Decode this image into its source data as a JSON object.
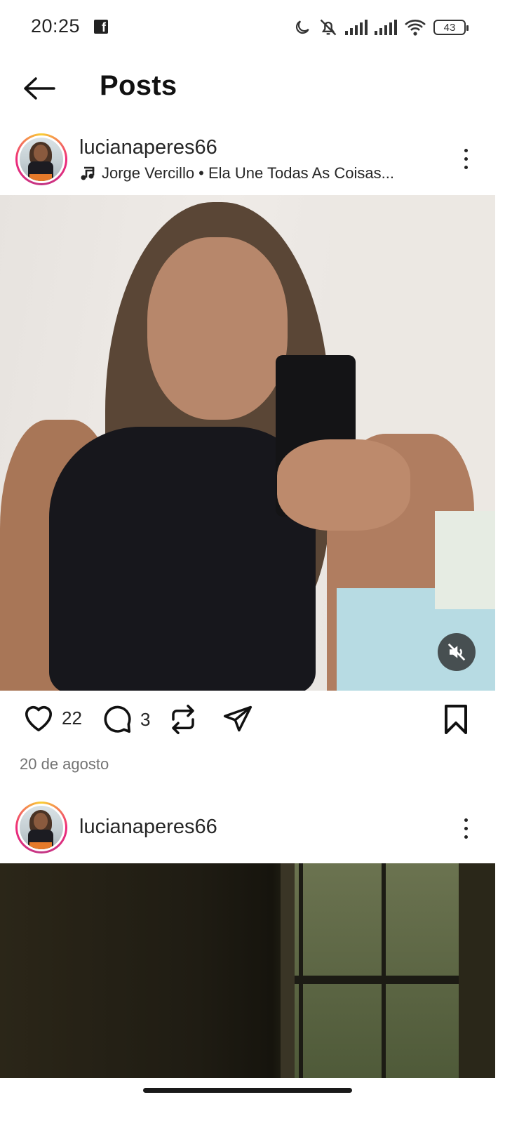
{
  "status_bar": {
    "time": "20:25",
    "battery": "43",
    "icons": [
      "facebook-icon",
      "moon-icon",
      "bell-off-icon",
      "signal-icon",
      "signal-icon",
      "wifi-icon",
      "battery-icon"
    ]
  },
  "header": {
    "title": "Posts",
    "back_icon": "arrow-left-icon"
  },
  "posts": [
    {
      "username": "lucianaperes66",
      "music": "Jorge Vercillo • Ela Une Todas As Coisas...",
      "likes": "22",
      "comments": "3",
      "date": "20 de agosto",
      "media_muted": true
    },
    {
      "username": "lucianaperes66"
    }
  ],
  "colors": {
    "ring_start": "#f9ce34",
    "ring_mid": "#ee2a7b",
    "ring_end": "#c13584",
    "text": "#262626",
    "muted_text": "#737373"
  }
}
